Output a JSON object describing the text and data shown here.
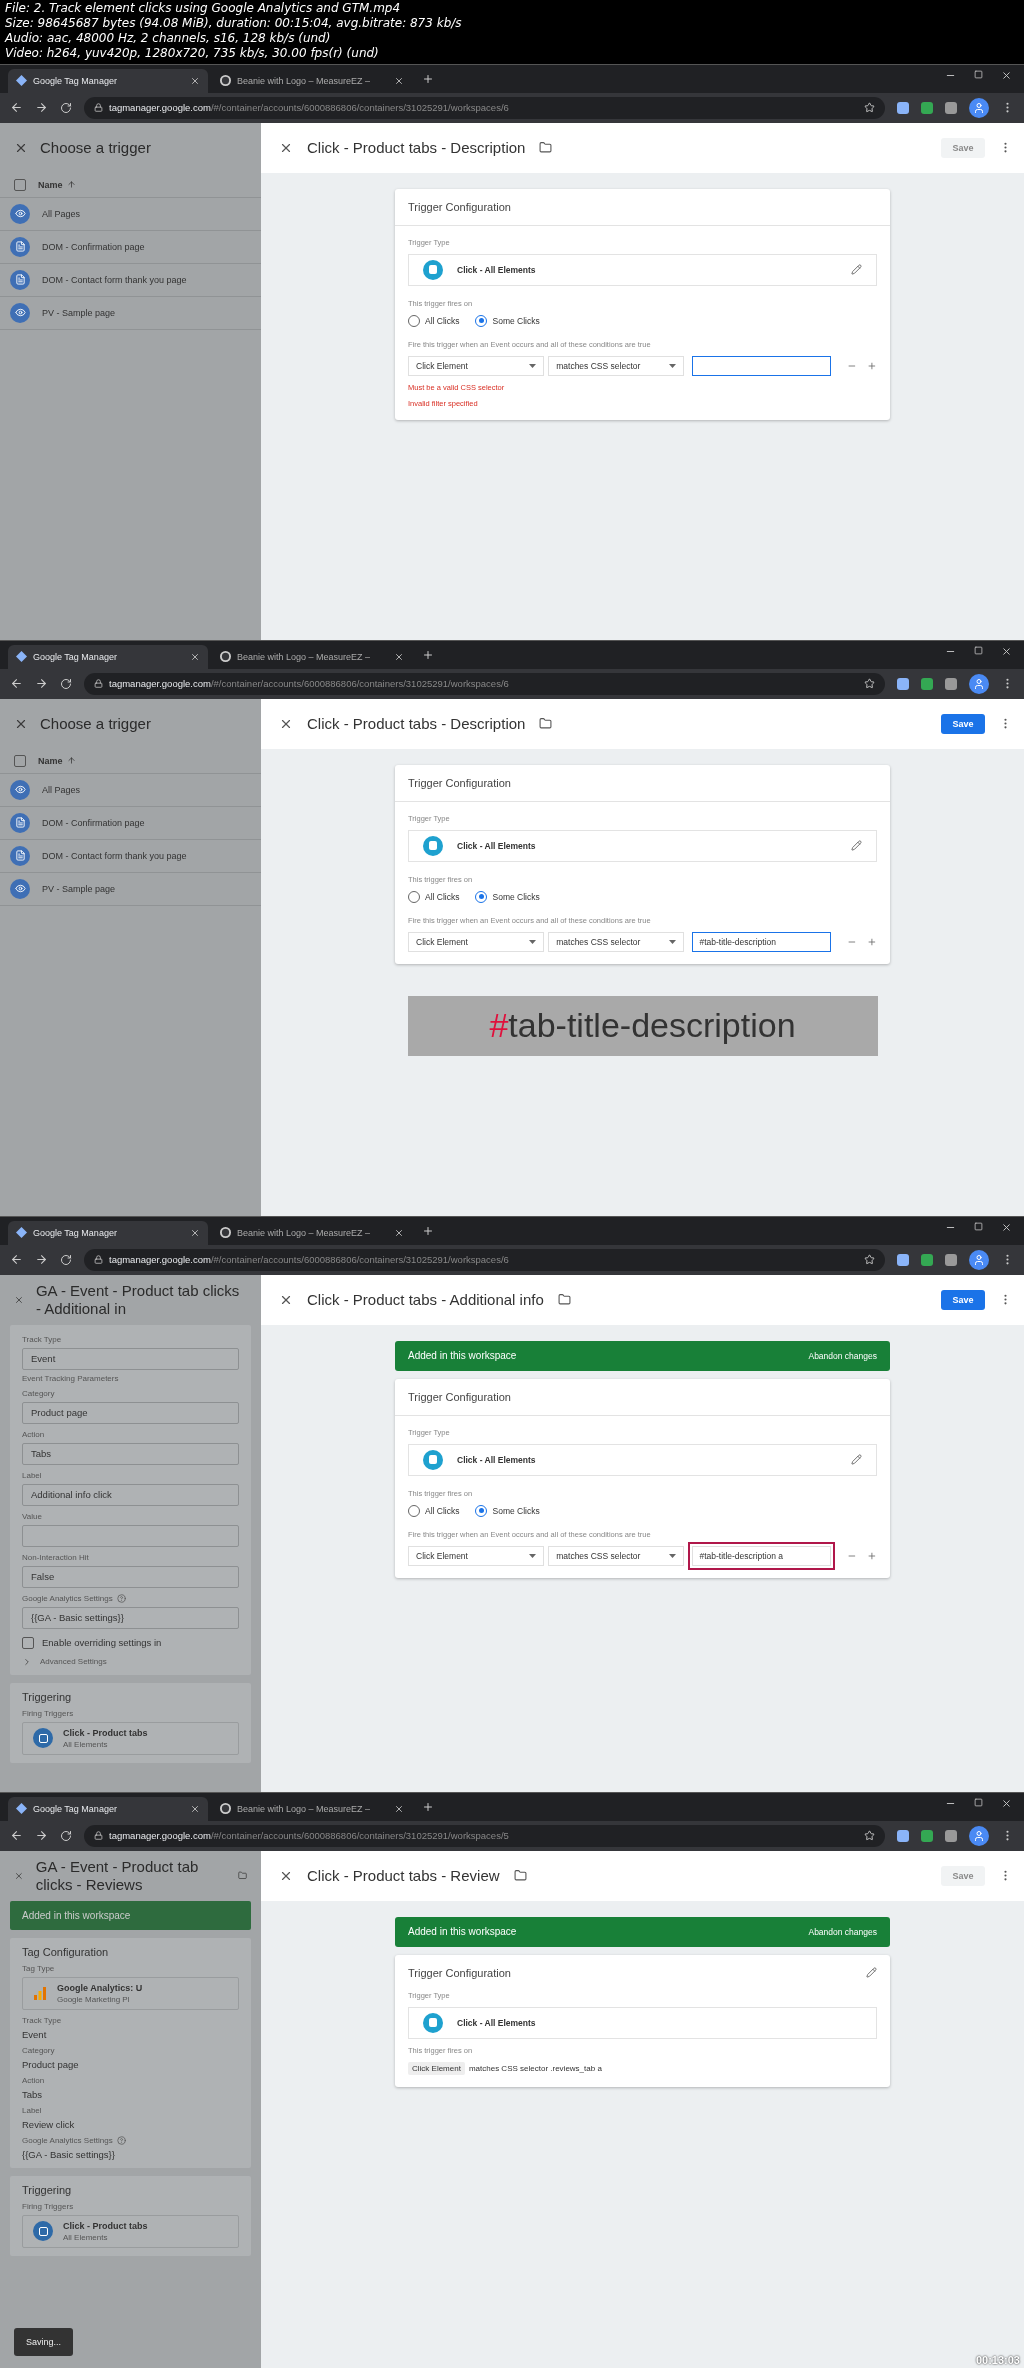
{
  "file_info": [
    "File: 2. Track element clicks using Google Analytics and GTM.mp4",
    "Size: 98645687 bytes (94.08 MiB), duration: 00:15:04, avg.bitrate: 873 kb/s",
    "Audio: aac, 48000 Hz, 2 channels, s16, 128 kb/s (und)",
    "Video: h264, yuv420p, 1280x720, 735 kb/s, 30.00 fps(r) (und)"
  ],
  "frames": [
    {
      "browser": {
        "tabs": [
          {
            "title": "Google Tag Manager",
            "selected": true
          },
          {
            "title": "Beanie with Logo – MeasureEZ –",
            "selected": false
          }
        ],
        "url_host": "tagmanager.google.com",
        "url_path": "/#/container/accounts/6000886806/containers/31025291/workspaces/6"
      },
      "left": {
        "kind": "trigger_list",
        "title": "Choose a trigger",
        "select_all_checked": false,
        "column": "Name",
        "items": [
          {
            "name": "All Pages",
            "kind": "pageview"
          },
          {
            "name": "DOM - Confirmation page",
            "kind": "dom"
          },
          {
            "name": "DOM - Contact form thank you page",
            "kind": "dom"
          },
          {
            "name": "PV - Sample page",
            "kind": "pageview"
          }
        ]
      },
      "right": {
        "title": "Click - Product tabs - Description",
        "save": {
          "label": "Save",
          "enabled": false
        },
        "card": {
          "kind": "edit",
          "title": "Trigger Configuration",
          "type_label": "Trigger Type",
          "type_name": "Click - All Elements",
          "fires_label": "This trigger fires on",
          "options": [
            {
              "label": "All Clicks",
              "selected": false
            },
            {
              "label": "Some Clicks",
              "selected": true
            }
          ],
          "conditions_label": "Fire this trigger when an Event occurs and all of these conditions are true",
          "condition": {
            "variable": "Click Element",
            "operator": "matches CSS selector",
            "focused": true,
            "highlighted": false
          },
          "errors": [
            "Must be a valid CSS selector",
            "Invalid filter specified"
          ]
        }
      }
    },
    {
      "browser": {
        "tabs": [
          {
            "title": "Google Tag Manager",
            "selected": true
          },
          {
            "title": "Beanie with Logo – MeasureEZ –",
            "selected": false
          }
        ],
        "url_host": "tagmanager.google.com",
        "url_path": "/#/container/accounts/6000886806/containers/31025291/workspaces/6"
      },
      "left": {
        "kind": "trigger_list",
        "title": "Choose a trigger",
        "select_all_checked": false,
        "column": "Name",
        "items": [
          {
            "name": "All Pages",
            "kind": "pageview"
          },
          {
            "name": "DOM - Confirmation page",
            "kind": "dom"
          },
          {
            "name": "DOM - Contact form thank you page",
            "kind": "dom"
          },
          {
            "name": "PV - Sample page",
            "kind": "pageview"
          }
        ]
      },
      "right": {
        "title": "Click - Product tabs - Description",
        "save": {
          "label": "Save",
          "enabled": true
        },
        "card": {
          "kind": "edit",
          "title": "Trigger Configuration",
          "type_label": "Trigger Type",
          "type_name": "Click - All Elements",
          "fires_label": "This trigger fires on",
          "options": [
            {
              "label": "All Clicks",
              "selected": false
            },
            {
              "label": "Some Clicks",
              "selected": true
            }
          ],
          "conditions_label": "Fire this trigger when an Event occurs and all of these conditions are true",
          "condition": {
            "variable": "Click Element",
            "operator": "matches CSS selector",
            "value": "#tab-title-description",
            "focused": true,
            "highlighted": false
          }
        },
        "callout": {
          "accent": "#",
          "text": "tab-title-description"
        }
      }
    },
    {
      "browser": {
        "tabs": [
          {
            "title": "Google Tag Manager",
            "selected": true
          },
          {
            "title": "Beanie with Logo – MeasureEZ –",
            "selected": false
          }
        ],
        "url_host": "tagmanager.google.com",
        "url_path": "/#/container/accounts/6000886806/containers/31025291/workspaces/6"
      },
      "left": {
        "kind": "tag_form",
        "title": "GA - Event - Product tab clicks - Additional in",
        "sections": [
          {
            "blocks": [
              {
                "kind": "field",
                "label": "Track Type",
                "value": "Event"
              },
              {
                "kind": "heading",
                "text": "Event Tracking Parameters"
              },
              {
                "kind": "field",
                "label": "Category",
                "value": "Product page"
              },
              {
                "kind": "field",
                "label": "Action",
                "value": "Tabs"
              },
              {
                "kind": "field",
                "label": "Label",
                "value": "Additional info click"
              },
              {
                "kind": "field",
                "label": "Value"
              },
              {
                "kind": "field",
                "label": "Non-Interaction Hit",
                "value": "False"
              },
              {
                "kind": "field",
                "label": "Google Analytics Settings",
                "help": true,
                "value": "{{GA - Basic settings}}"
              },
              {
                "kind": "checkbox",
                "label": "Enable overriding settings in",
                "checked": false
              },
              {
                "kind": "expander",
                "label": "Advanced Settings"
              }
            ]
          },
          {
            "title": "Triggering",
            "blocks": [
              {
                "kind": "heading",
                "text": "Firing Triggers"
              },
              {
                "kind": "trigger",
                "name": "Click - Product tabs",
                "sub": "All Elements"
              }
            ]
          }
        ]
      },
      "right": {
        "title": "Click - Product tabs - Additional info",
        "save": {
          "label": "Save",
          "enabled": true
        },
        "banner": {
          "text": "Added in this workspace",
          "action": "Abandon changes"
        },
        "card": {
          "kind": "edit",
          "title": "Trigger Configuration",
          "type_label": "Trigger Type",
          "type_name": "Click - All Elements",
          "fires_label": "This trigger fires on",
          "options": [
            {
              "label": "All Clicks",
              "selected": false
            },
            {
              "label": "Some Clicks",
              "selected": true
            }
          ],
          "conditions_label": "Fire this trigger when an Event occurs and all of these conditions are true",
          "condition": {
            "variable": "Click Element",
            "operator": "matches CSS selector",
            "value": "#tab-title-description a",
            "focused": false,
            "highlighted": true
          }
        }
      }
    },
    {
      "browser": {
        "tabs": [
          {
            "title": "Google Tag Manager",
            "selected": true
          },
          {
            "title": "Beanie with Logo – MeasureEZ –",
            "selected": false
          }
        ],
        "url_host": "tagmanager.google.com",
        "url_path": "/#/container/accounts/6000886806/containers/31025291/workspaces/5"
      },
      "left": {
        "kind": "tag_form",
        "title": "GA - Event - Product tab clicks - Reviews",
        "folder": true,
        "banner": "Added in this workspace",
        "sections": [
          {
            "title": "Tag Configuration",
            "blocks": [
              {
                "kind": "heading",
                "text": "Tag Type"
              },
              {
                "kind": "tag_type",
                "name": "Google Analytics: U",
                "sub": "Google Marketing Pl"
              },
              {
                "kind": "text",
                "label": "Track Type",
                "value": "Event"
              },
              {
                "kind": "text",
                "label": "Category",
                "value": "Product page"
              },
              {
                "kind": "text",
                "label": "Action",
                "value": "Tabs"
              },
              {
                "kind": "text",
                "label": "Label",
                "value": "Review click"
              },
              {
                "kind": "text",
                "label": "Google Analytics Settings",
                "help": true,
                "value": "{{GA - Basic settings}}"
              }
            ]
          },
          {
            "title": "Triggering",
            "blocks": [
              {
                "kind": "heading",
                "text": "Firing Triggers"
              },
              {
                "kind": "trigger",
                "name": "Click - Product tabs",
                "sub": "All Elements"
              }
            ]
          }
        ],
        "toast": "Saving..."
      },
      "right": {
        "title": "Click - Product tabs - Review",
        "save": {
          "label": "Save",
          "enabled": false
        },
        "banner": {
          "text": "Added in this workspace",
          "action": "Abandon changes"
        },
        "card": {
          "kind": "summary",
          "title": "Trigger Configuration",
          "type_label": "Trigger Type",
          "type_name": "Click - All Elements",
          "fires_label": "This trigger fires on",
          "summary": {
            "chip": "Click Element",
            "text": "matches CSS selector .reviews_tab a"
          }
        }
      },
      "timestamp": "00:13:03"
    }
  ]
}
